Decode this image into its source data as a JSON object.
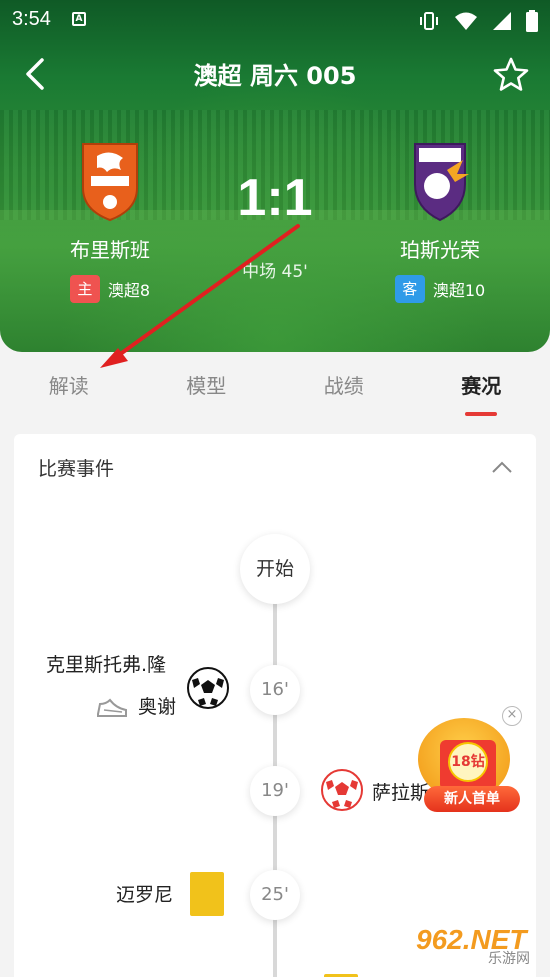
{
  "status_bar": {
    "time": "3:54",
    "notif_glyph": "A"
  },
  "header": {
    "title": "澳超 周六 005",
    "home": {
      "name": "布里斯班",
      "badge": "主",
      "league_rank": "澳超8"
    },
    "away": {
      "name": "珀斯光荣",
      "badge": "客",
      "league_rank": "澳超10"
    },
    "score": "1:1",
    "status": "中场 45'"
  },
  "tabs": [
    {
      "label": "解读",
      "active": false
    },
    {
      "label": "模型",
      "active": false
    },
    {
      "label": "战绩",
      "active": false
    },
    {
      "label": "赛况",
      "active": true
    }
  ],
  "events": {
    "section_title": "比赛事件",
    "start_label": "开始",
    "items": [
      {
        "minute": "16'",
        "side": "home",
        "type": "goal",
        "player_line1": "克里斯托弗.隆",
        "player_line2": "奥谢"
      },
      {
        "minute": "19'",
        "side": "away",
        "type": "goal",
        "player": "萨拉斯"
      },
      {
        "minute": "25'",
        "side": "home",
        "type": "yellow-card",
        "player": "迈罗尼"
      }
    ]
  },
  "promo": {
    "coin_text": "18钻",
    "label": "新人首单"
  },
  "watermark": {
    "number": "962.NET",
    "sub": "乐游网"
  },
  "colors": {
    "accent_red": "#e53935",
    "home_badge": "#ef5350",
    "away_badge": "#2f9be8",
    "yellow_card": "#f1c21b"
  }
}
